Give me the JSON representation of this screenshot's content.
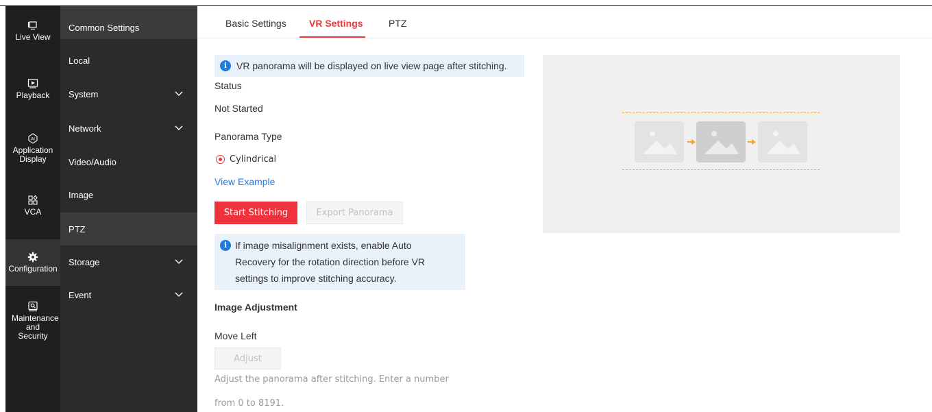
{
  "rail": {
    "items": [
      {
        "label": "Live View",
        "icon": "monitor-icon"
      },
      {
        "label": "Playback",
        "icon": "playback-icon"
      },
      {
        "label": "Application Display",
        "icon": "ai-icon"
      },
      {
        "label": "VCA",
        "icon": "vca-icon"
      },
      {
        "label": "Configuration",
        "icon": "gear-icon"
      },
      {
        "label": "Maintenance and Security",
        "icon": "maintenance-icon"
      }
    ],
    "active": "Configuration"
  },
  "submenu": {
    "items": [
      {
        "label": "Common Settings"
      },
      {
        "label": "Local"
      },
      {
        "label": "System",
        "expandable": true
      },
      {
        "label": "Network",
        "expandable": true
      },
      {
        "label": "Video/Audio"
      },
      {
        "label": "Image"
      },
      {
        "label": "PTZ"
      },
      {
        "label": "Storage",
        "expandable": true
      },
      {
        "label": "Event",
        "expandable": true
      }
    ],
    "active": "PTZ"
  },
  "tabs": [
    {
      "label": "Basic Settings"
    },
    {
      "label": "VR Settings"
    },
    {
      "label": "PTZ"
    }
  ],
  "active_tab": "VR Settings",
  "main": {
    "notice": "VR panorama will be displayed on live view page after stitching.",
    "status_label": "Status",
    "status_value": "Not Started",
    "panorama_type_label": "Panorama Type",
    "panorama_option": "Cylindrical",
    "view_example": "View Example",
    "start_stitching": "Start Stitching",
    "export_panorama": "Export Panorama",
    "warning_lines": [
      "If image misalignment exists, enable Auto",
      "Recovery for the rotation direction before VR",
      "settings to improve stitching accuracy."
    ],
    "image_adjustment": "Image Adjustment",
    "move_left": "Move Left",
    "adjust": "Adjust",
    "hint_lines": [
      "Adjust the panorama after stitching. Enter a number",
      "from 0 to 8191."
    ]
  },
  "colors": {
    "accent": "#e83b3b",
    "primary_button": "#f0323c",
    "link": "#1e7be0",
    "notice_bg": "#e9f2fb",
    "rail_bg": "#1f1f1f",
    "submenu_bg": "#2b2b2b"
  }
}
